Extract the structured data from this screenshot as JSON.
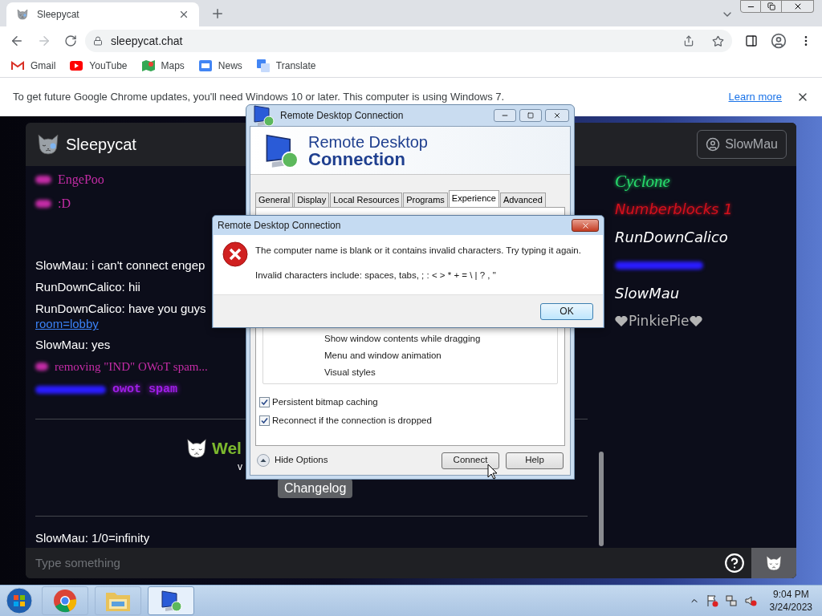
{
  "browser": {
    "tab": {
      "title": "Sleepycat"
    },
    "url": "sleepycat.chat",
    "bookmarks": [
      {
        "label": "Gmail",
        "kind": "gmail"
      },
      {
        "label": "YouTube",
        "kind": "youtube"
      },
      {
        "label": "Maps",
        "kind": "maps"
      },
      {
        "label": "News",
        "kind": "news"
      },
      {
        "label": "Translate",
        "kind": "translate"
      }
    ],
    "infobar": {
      "message": "To get future Google Chrome updates, you'll need Windows 10 or later. This computer is using Windows 7.",
      "link": "Learn more"
    }
  },
  "chat": {
    "app_name": "Sleepycat",
    "user_button": "SlowMau",
    "history": [
      {
        "kind": "styled",
        "text": "EngePoo",
        "color": "#c42ca6"
      },
      {
        "kind": "styled",
        "text": ":D",
        "color": "#c42ca6"
      }
    ],
    "messages": [
      {
        "kind": "plain",
        "text": "SlowMau: i can't connect engep"
      },
      {
        "kind": "plain",
        "text": "RunDownCalico: hii"
      },
      {
        "kind": "plain",
        "text": "RunDownCalico: have you guys",
        "link": "room=lobby"
      },
      {
        "kind": "plain",
        "text": "SlowMau: yes"
      },
      {
        "kind": "styled",
        "text": "removing \"IND\" OWoT spam...",
        "color": "#c42ca6"
      },
      {
        "kind": "glow",
        "text": "owot spam",
        "color": "#a01ee8"
      }
    ],
    "welcome": {
      "title": "Wel",
      "subtitle": "v",
      "changelog_button": "Changelog"
    },
    "last_message": "SlowMau: 1/0=infinity",
    "input": {
      "placeholder": "Type something"
    },
    "users": [
      {
        "kind": "serif",
        "name": "Cyclone",
        "color": "#27dc6c"
      },
      {
        "kind": "sans",
        "name": "Numberblocks 1",
        "color": "#d4101c"
      },
      {
        "kind": "sans",
        "name": "RunDownCalico",
        "color": "#ffffff"
      },
      {
        "kind": "blurred",
        "color": "#2a1cff"
      },
      {
        "kind": "sans",
        "name": "SlowMau",
        "color": "#ffffff"
      },
      {
        "kind": "hearts",
        "name": "PinkiePie",
        "color": "#b4b4b4"
      }
    ]
  },
  "rdc_window": {
    "title": "Remote Desktop Connection",
    "banner_line_1": "Remote Desktop",
    "banner_line_2": "Connection",
    "tabs": [
      {
        "label": "General",
        "selected": false
      },
      {
        "label": "Display",
        "selected": false
      },
      {
        "label": "Local Resources",
        "selected": false
      },
      {
        "label": "Programs",
        "selected": false
      },
      {
        "label": "Experience",
        "selected": true
      },
      {
        "label": "Advanced",
        "selected": false
      }
    ],
    "features": [
      "Show window contents while dragging",
      "Menu and window animation",
      "Visual styles"
    ],
    "checkboxes": [
      {
        "label": "Persistent bitmap caching",
        "checked": true
      },
      {
        "label": "Reconnect if the connection is dropped",
        "checked": true
      }
    ],
    "hide_options": "Hide Options",
    "buttons": [
      "Connect",
      "Help"
    ]
  },
  "error_dialog": {
    "title": "Remote Desktop Connection",
    "message": "The computer name is blank or it contains invalid characters. Try typing it again.",
    "detail": "Invalid characters include: spaces, tabs, ; : < > * + = \\ | ? , \"",
    "button": "OK"
  },
  "taskbar": {
    "apps": [
      {
        "kind": "chrome",
        "selected": false
      },
      {
        "kind": "folder",
        "selected": false
      },
      {
        "kind": "rdc",
        "selected": true
      }
    ],
    "time": "9:04 PM",
    "date": "3/24/2023"
  }
}
